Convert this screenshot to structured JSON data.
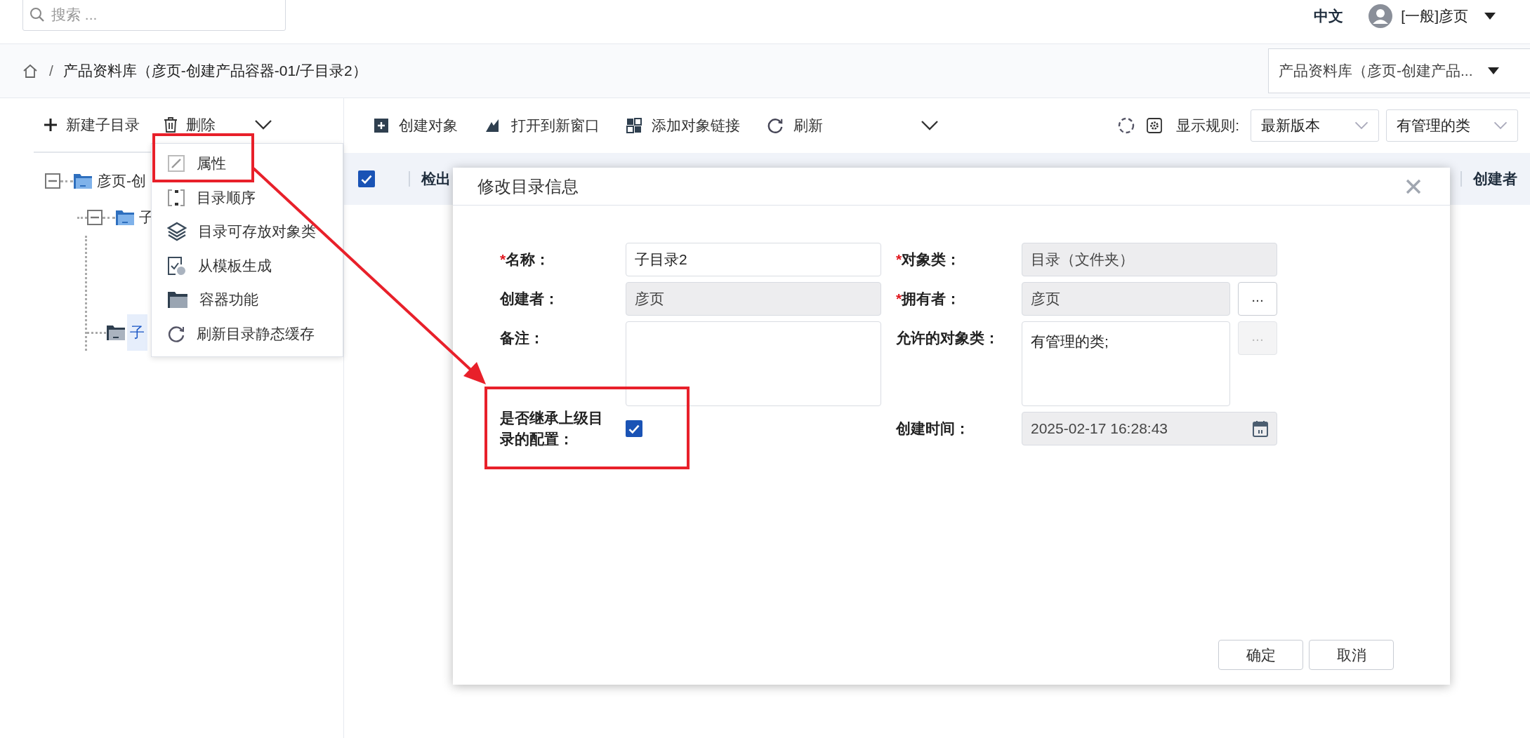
{
  "search": {
    "placeholder": "搜索 ..."
  },
  "header": {
    "language": {
      "label": "中文",
      "selected": true
    },
    "user": "[一般]彦页"
  },
  "breadcrumb": {
    "separator": "/",
    "path": "产品资料库（彦页-创建产品容器-01/子目录2）",
    "library_select": "产品资料库（彦页-创建产品..."
  },
  "tree_toolbar": [
    {
      "kind": "plus",
      "label": "新建子目录"
    },
    {
      "kind": "trash",
      "label": "删除"
    }
  ],
  "tree": [
    {
      "label": "彦页-创",
      "kind": "folder",
      "expanded": true,
      "selected": false,
      "children": [
        {
          "label": "子",
          "kind": "folder",
          "expanded": true,
          "selected": false,
          "children": [
            {
              "label": "子",
              "kind": "container",
              "selected": true
            }
          ]
        }
      ]
    }
  ],
  "context_menu": [
    {
      "kind": "edit",
      "label": "属性"
    },
    {
      "kind": "order",
      "label": "目录顺序"
    },
    {
      "kind": "layers",
      "label": "目录可存放对象类"
    },
    {
      "kind": "template",
      "label": "从模板生成"
    },
    {
      "kind": "folder",
      "label": "容器功能"
    },
    {
      "kind": "refresh",
      "label": "刷新目录静态缓存"
    }
  ],
  "toolbar": [
    {
      "kind": "create",
      "label": "创建对象"
    },
    {
      "kind": "open",
      "label": "打开到新窗口"
    },
    {
      "kind": "link",
      "label": "添加对象链接"
    },
    {
      "kind": "refresh",
      "label": "刷新"
    }
  ],
  "display_rule": {
    "label": "显示规则:",
    "selects": [
      "最新版本",
      "有管理的类"
    ]
  },
  "table": {
    "all_checked": true,
    "columns": [
      "检出",
      "创建者"
    ]
  },
  "dialog": {
    "title": "修改目录信息",
    "fields": [
      {
        "marker": "*",
        "label": "名称：",
        "kind": "input",
        "value": "子目录2",
        "disabled": false
      },
      {
        "marker": "*",
        "label": "对象类：",
        "kind": "input",
        "value": "目录（文件夹）",
        "disabled": true
      },
      {
        "label": "创建者：",
        "kind": "input",
        "value": "彦页",
        "disabled": true
      },
      {
        "marker": "*",
        "label": "拥有者：",
        "kind": "input",
        "value": "彦页",
        "disabled": true,
        "picker": {
          "label": "...",
          "disabled": false
        }
      },
      {
        "label": "备注：",
        "kind": "textarea",
        "disabled": false
      },
      {
        "label": "允许的对象类：",
        "kind": "textarea",
        "value": "有管理的类;",
        "disabled": false,
        "picker": {
          "label": "...",
          "disabled": true
        }
      },
      {
        "label": "是否继承上级目录的配置：",
        "kind": "checkbox",
        "checked": true
      },
      {
        "label": "创建时间：",
        "kind": "date",
        "value": "2025-02-17 16:28:43",
        "disabled": true
      }
    ],
    "buttons": [
      "确定",
      "取消"
    ]
  }
}
